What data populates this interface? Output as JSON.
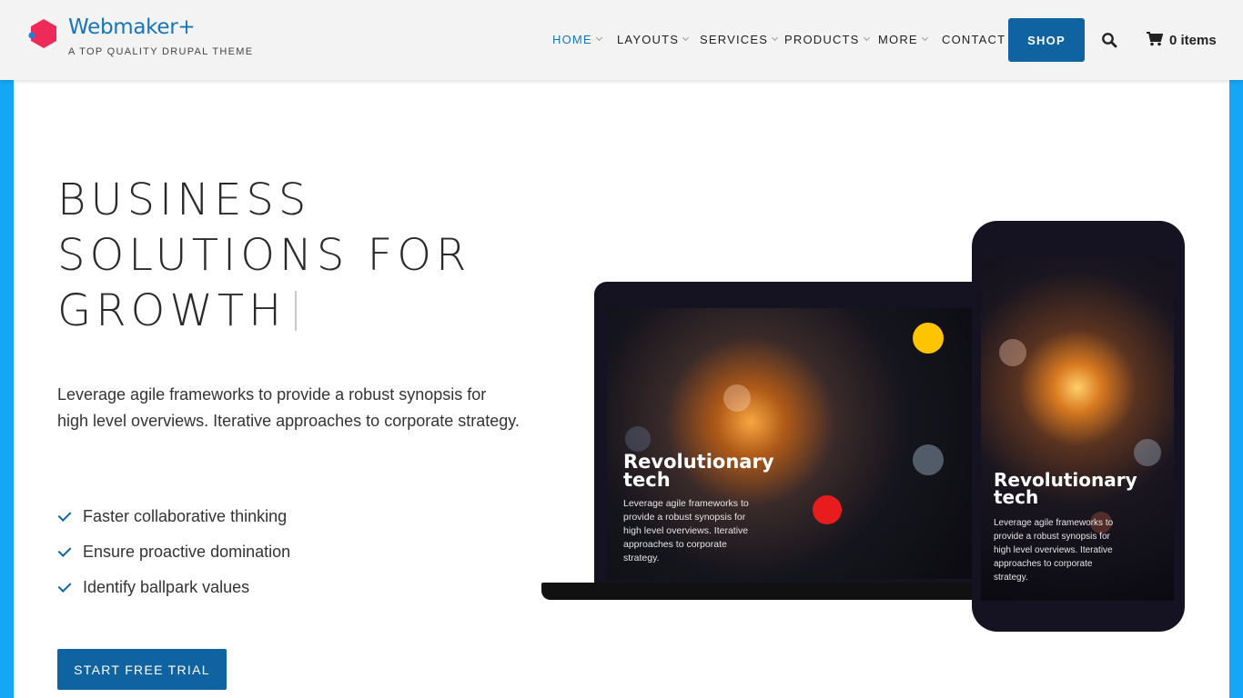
{
  "brand": {
    "name": "Webmaker+",
    "tagline": "A TOP QUALITY DRUPAL THEME",
    "logo_icon": "hexagon-logo-icon",
    "logo_color": "#ee2a58",
    "accent_color": "#1775b8"
  },
  "nav": {
    "items": [
      {
        "label": "HOME",
        "dropdown": true,
        "active": true
      },
      {
        "label": "LAYOUTS",
        "dropdown": true
      },
      {
        "label": "SERVICES",
        "dropdown": true
      },
      {
        "label": "PRODUCTS",
        "dropdown": true
      },
      {
        "label": "MORE",
        "dropdown": true
      },
      {
        "label": "CONTACT",
        "dropdown": false
      }
    ],
    "shop_label": "SHOP",
    "search_icon": "search-icon",
    "cart_icon": "cart-icon",
    "cart_label": "0 items"
  },
  "hero": {
    "title_lines": [
      "BUSINESS",
      "SOLUTIONS FOR",
      "GROWTH"
    ],
    "description": "Leverage agile frameworks to provide a robust synopsis for high level overviews. Iterative approaches to corporate strategy.",
    "checklist": [
      "Faster collaborative thinking",
      "Ensure proactive domination",
      "Identify ballpark values"
    ],
    "cta_label": "START FREE TRIAL",
    "button_color": "#0f63a0"
  },
  "devices": {
    "laptop_card": {
      "title_lines": [
        "Revolutionary",
        "tech"
      ],
      "body_lines": [
        "Leverage agile frameworks to",
        "provide a robust synopsis for",
        "high level overviews. Iterative",
        "approaches to corporate",
        "strategy."
      ]
    },
    "phone_card": {
      "title_lines": [
        "Revolutionary",
        "tech"
      ],
      "body_lines": [
        "Leverage agile frameworks to",
        "provide a robust synopsis for",
        "high level overviews. Iterative",
        "approaches to corporate",
        "strategy."
      ]
    }
  },
  "page_border_color": "#14a7f5"
}
